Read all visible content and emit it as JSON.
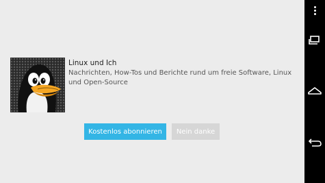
{
  "subscription": {
    "title": "Linux und Ich",
    "description": "Nachrichten, How-Tos und Berichte rund um freie Software, Linux und Open-Source",
    "logo_icon": "tux-penguin-logo"
  },
  "actions": {
    "subscribe_label": "Kostenlos abonnieren",
    "decline_label": "Nein danke"
  },
  "navigation_bar": {
    "items": [
      "overflow-menu-icon",
      "recent-apps-icon",
      "home-icon",
      "back-icon"
    ]
  },
  "colors": {
    "accent": "#33b5e5",
    "disabled": "#d6d6d6",
    "background": "#ececec",
    "navbar": "#000000"
  }
}
